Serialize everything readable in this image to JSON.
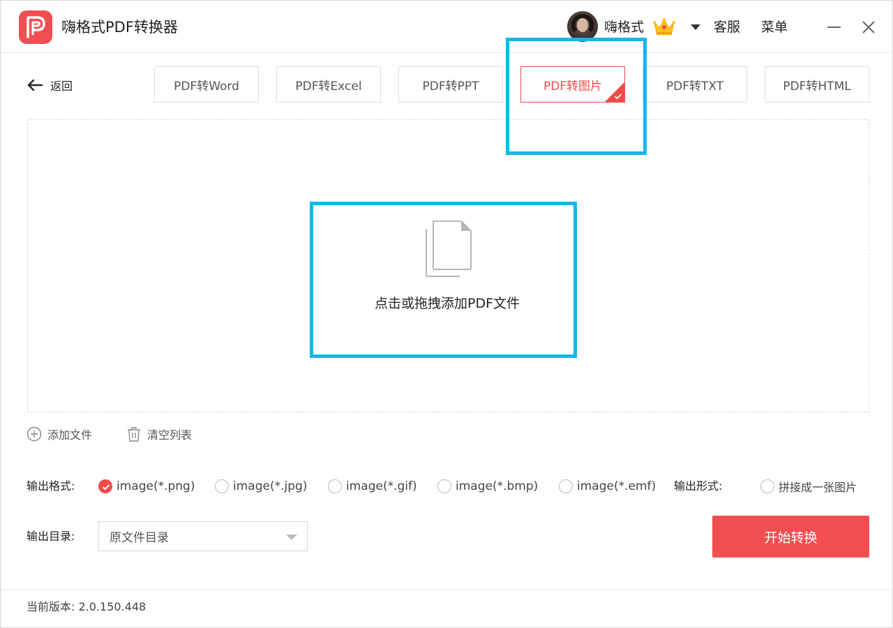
{
  "app": {
    "title": "嗨格式PDF转换器",
    "username": "嗨格式",
    "service_label": "客服",
    "menu_label": "菜单"
  },
  "nav": {
    "back_label": "返回",
    "tabs": [
      {
        "label": "PDF转Word",
        "active": false
      },
      {
        "label": "PDF转Excel",
        "active": false
      },
      {
        "label": "PDF转PPT",
        "active": false
      },
      {
        "label": "PDF转图片",
        "active": true
      },
      {
        "label": "PDF转TXT",
        "active": false
      },
      {
        "label": "PDF转HTML",
        "active": false
      }
    ]
  },
  "dropzone": {
    "hint": "点击或拖拽添加PDF文件",
    "icon": "document-stack-icon"
  },
  "actions": {
    "add_file": "添加文件",
    "clear_list": "清空列表"
  },
  "output_format": {
    "label": "输出格式:",
    "options": [
      {
        "label": "image(*.png)",
        "checked": true
      },
      {
        "label": "image(*.jpg)",
        "checked": false
      },
      {
        "label": "image(*.gif)",
        "checked": false
      },
      {
        "label": "image(*.bmp)",
        "checked": false
      },
      {
        "label": "image(*.emf)",
        "checked": false
      }
    ],
    "mode_label": "输出形式:",
    "merge_option": {
      "label": "拼接成一张图片",
      "checked": false
    }
  },
  "output_dir": {
    "label": "输出目录:",
    "selected": "原文件目录"
  },
  "start_button": "开始转换",
  "version": "当前版本: 2.0.150.448",
  "colors": {
    "accent": "#f24e50",
    "highlight": "#17b5ea"
  }
}
